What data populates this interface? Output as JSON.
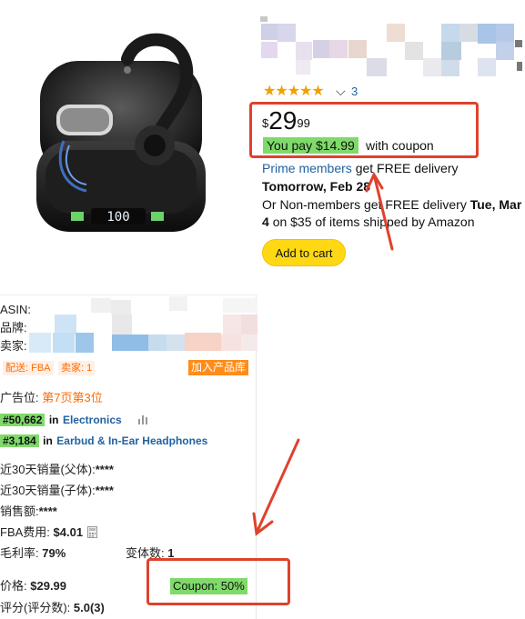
{
  "product": {
    "rating": {
      "stars_value": 5,
      "stars_text": "★★★★★",
      "count": "3",
      "chevron": "⌵"
    },
    "price": {
      "symbol": "$",
      "whole": "29",
      "fraction": "99"
    },
    "coupon": {
      "badge": "You pay $14.99",
      "tail": "with coupon"
    },
    "delivery": {
      "prime_link": "Prime members",
      "prime_rest": "get FREE delivery",
      "prime_date": "Tomorrow, Feb 28",
      "nonmember_text": "Or Non-members get FREE delivery",
      "nonmember_date": "Tue, Mar",
      "line3_bold": "4",
      "line3_rest": "on $35 of items shipped by Amazon"
    },
    "add_to_cart": "Add to cart",
    "image_display": "100"
  },
  "extension": {
    "asin_label": "ASIN:",
    "brand_label": "品牌:",
    "seller_label": "卖家:",
    "tags": {
      "fba": "配送: FBA",
      "sellers": "卖家: 1",
      "add_lib": "加入产品库"
    },
    "ad_position": {
      "label": "广告位:",
      "value": "第7页第3位"
    },
    "rank1": {
      "badge": "#50,662",
      "in": "in",
      "category": "Electronics"
    },
    "rank2": {
      "badge": "#3,184",
      "in": "in",
      "category": "Earbud & In-Ear Headphones"
    },
    "sales_parent": {
      "label": "近30天销量(父体):",
      "value": "****"
    },
    "sales_child": {
      "label": "近30天销量(子体):",
      "value": "****"
    },
    "revenue": {
      "label": "销售额:",
      "value": "****"
    },
    "fba_fee": {
      "label": "FBA费用:",
      "value": "$4.01"
    },
    "margin": {
      "label": "毛利率:",
      "value": "79%"
    },
    "variants": {
      "label": "变体数:",
      "value": "1"
    },
    "price": {
      "label": "价格:",
      "value": "$29.99"
    },
    "coupon": "Coupon: 50%",
    "rating": {
      "label": "评分(评分数):",
      "value": "5.0(3)"
    }
  },
  "colors": {
    "highlight_red": "#e0412d",
    "coupon_green": "#7fda69",
    "link_blue": "#2162a1",
    "star_orange": "#f0a000",
    "cart_yellow": "#ffd814",
    "ext_orange": "#ff6a00"
  }
}
